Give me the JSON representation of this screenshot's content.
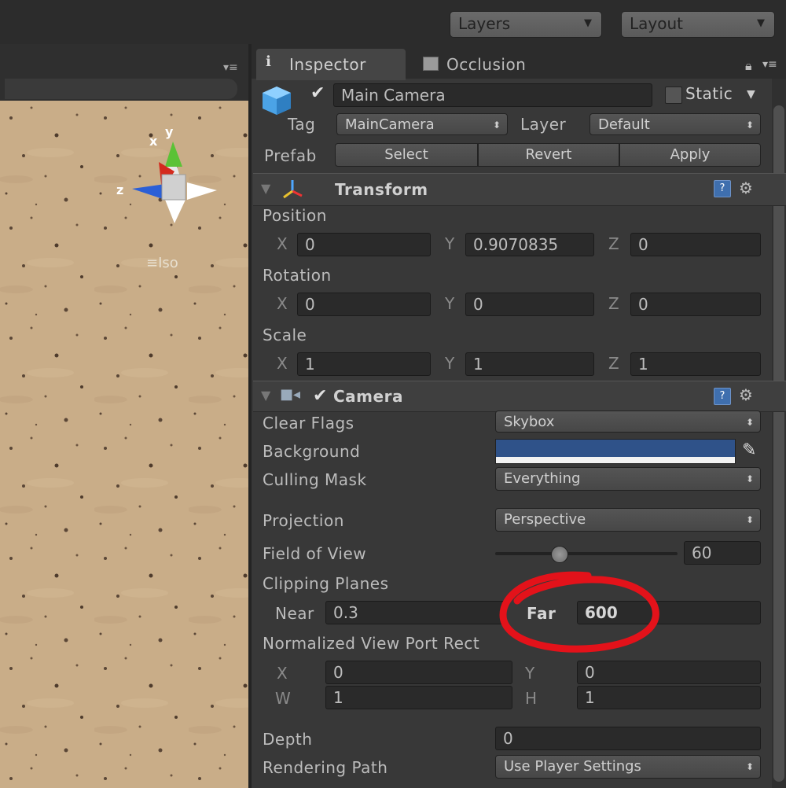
{
  "toolbar": {
    "layers_label": "Layers",
    "layout_label": "Layout"
  },
  "scene": {
    "gizmo_x": "x",
    "gizmo_y": "y",
    "gizmo_z": "z",
    "iso_label": "Iso"
  },
  "tabs": {
    "inspector": "Inspector",
    "occlusion": "Occlusion"
  },
  "object": {
    "name": "Main Camera",
    "static_label": "Static",
    "tag_label": "Tag",
    "tag_value": "MainCamera",
    "layer_label": "Layer",
    "layer_value": "Default",
    "prefab_label": "Prefab",
    "select_label": "Select",
    "revert_label": "Revert",
    "apply_label": "Apply"
  },
  "transform": {
    "title": "Transform",
    "position_label": "Position",
    "rotation_label": "Rotation",
    "scale_label": "Scale",
    "axes": {
      "x": "X",
      "y": "Y",
      "z": "Z"
    },
    "position": {
      "x": "0",
      "y": "0.9070835",
      "z": "0"
    },
    "rotation": {
      "x": "0",
      "y": "0",
      "z": "0"
    },
    "scale": {
      "x": "1",
      "y": "1",
      "z": "1"
    }
  },
  "camera": {
    "title": "Camera",
    "clear_flags_label": "Clear Flags",
    "clear_flags_value": "Skybox",
    "background_label": "Background",
    "background_color": "#2f5289",
    "culling_mask_label": "Culling Mask",
    "culling_mask_value": "Everything",
    "projection_label": "Projection",
    "projection_value": "Perspective",
    "fov_label": "Field of View",
    "fov_value": "60",
    "fov_slider_fraction": 0.35,
    "clipping_label": "Clipping Planes",
    "near_label": "Near",
    "near_value": "0.3",
    "far_label": "Far",
    "far_value": "600",
    "viewport_label": "Normalized View Port Rect",
    "vp_x_label": "X",
    "vp_x": "0",
    "vp_y_label": "Y",
    "vp_y": "0",
    "vp_w_label": "W",
    "vp_w": "1",
    "vp_h_label": "H",
    "vp_h": "1",
    "depth_label": "Depth",
    "depth_value": "0",
    "rendering_path_label": "Rendering Path",
    "rendering_path_value": "Use Player Settings"
  },
  "annotation": {
    "color": "#e3121a"
  }
}
